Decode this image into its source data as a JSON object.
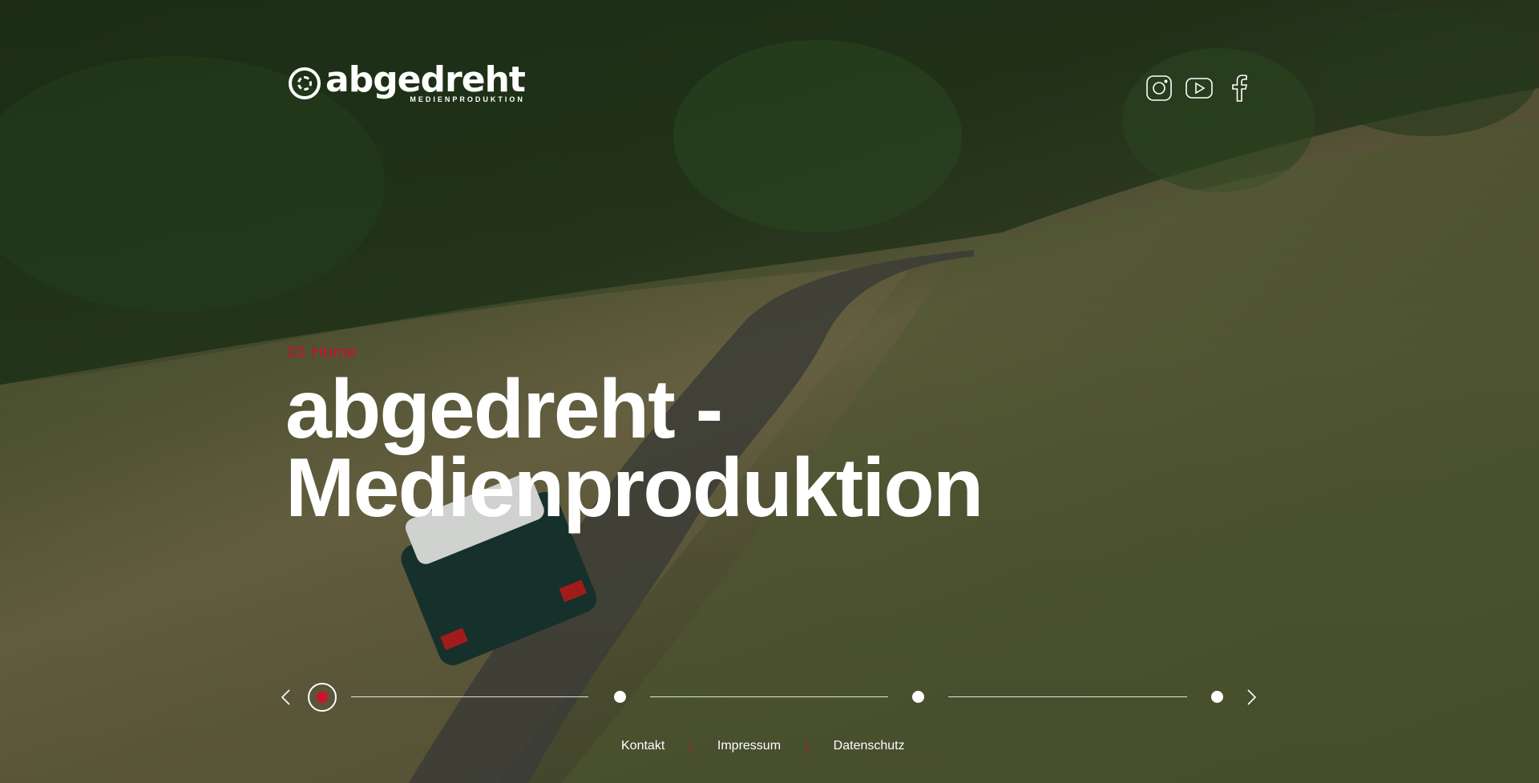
{
  "brand": {
    "logo_word": "abgedreht",
    "logo_subtitle": "MEDIENPRODUKTION"
  },
  "social": [
    {
      "icon": "instagram-icon"
    },
    {
      "icon": "youtube-icon"
    },
    {
      "icon": "facebook-icon"
    }
  ],
  "hero": {
    "section_label": "01 Home",
    "headline_line1": "abgedreht -",
    "headline_line2": "Medienproduktion",
    "background_icon": "drone-landscape-image"
  },
  "slider": {
    "slide_count": 4,
    "active_index": 0,
    "prev_icon": "chevron-left-icon",
    "next_icon": "chevron-right-icon"
  },
  "footer": {
    "links": [
      "Kontakt",
      "Impressum",
      "Datenschutz"
    ],
    "separator": "|"
  },
  "colors": {
    "accent": "#c8102e",
    "text": "#ffffff"
  }
}
